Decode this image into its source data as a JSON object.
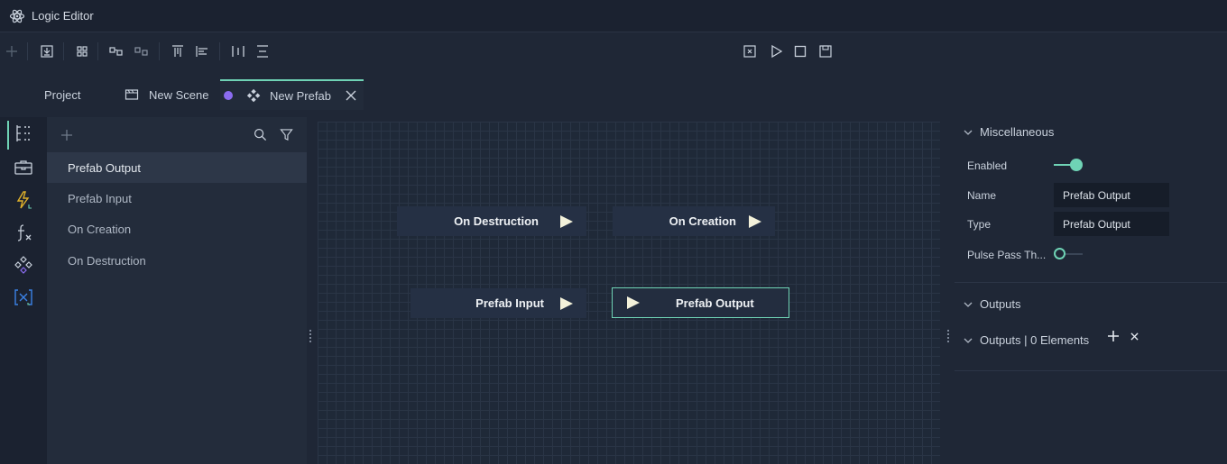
{
  "window": {
    "title": "Logic Editor"
  },
  "tabs": [
    {
      "label": "Project"
    },
    {
      "label": "New Scene"
    },
    {
      "label": "New Prefab"
    }
  ],
  "node_list": {
    "items": [
      {
        "label": "Prefab Output"
      },
      {
        "label": "Prefab Input"
      },
      {
        "label": "On Creation"
      },
      {
        "label": "On Destruction"
      }
    ]
  },
  "canvas": {
    "nodes": [
      {
        "label": "On Destruction"
      },
      {
        "label": "On Creation"
      },
      {
        "label": "Prefab Input"
      },
      {
        "label": "Prefab Output"
      }
    ]
  },
  "inspector": {
    "misc_section": "Miscellaneous",
    "enabled_label": "Enabled",
    "enabled_value": true,
    "name_label": "Name",
    "name_value": "Prefab Output",
    "type_label": "Type",
    "type_value": "Prefab Output",
    "pulse_label": "Pulse Pass Th...",
    "pulse_value": false,
    "outputs_section": "Outputs",
    "outputs_list_label": "Outputs | 0 Elements"
  },
  "colors": {
    "accent": "#6fd3b5",
    "prefab_dot": "#8b6cf0",
    "rail_event": "#e0b12a",
    "rail_variable": "#3b82e6"
  },
  "icons": {
    "app": "atom-icon",
    "toolbar": [
      "add-icon",
      "import-icon",
      "group-icon",
      "align-nodes-icon",
      "distribute-nodes-icon",
      "align-top-icon",
      "align-left-icon",
      "distribute-horizontal-icon",
      "distribute-vertical-icon",
      "export-icon",
      "play-icon",
      "stop-icon",
      "save-icon"
    ],
    "rail": [
      "hierarchy-icon",
      "toolbox-icon",
      "events-icon",
      "functions-icon",
      "prefab-icon",
      "variables-icon"
    ]
  }
}
